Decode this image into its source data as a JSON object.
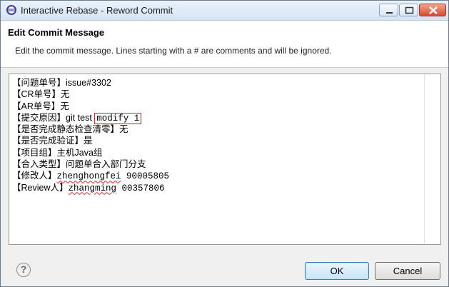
{
  "window": {
    "title": "Interactive Rebase - Reword Commit"
  },
  "header": {
    "title": "Edit Commit Message",
    "description": "Edit the commit message. Lines starting with a # are comments and will be ignored."
  },
  "editor": {
    "lines": [
      "【问题单号】issue#3302",
      "【CR单号】无",
      "【AR单号】无",
      "【提交原因】git test ",
      "modify 1",
      "【是否完成静态检查清零】无",
      "【是否完成验证】是",
      "【项目组】主机Java组",
      "【合入类型】问题单合入部门分支",
      "【修改人】",
      "zhenghongfei",
      " 90005805",
      "【Review人】",
      "zhangming",
      " 00357806"
    ]
  },
  "footer": {
    "help_glyph": "?",
    "ok_label": "OK",
    "cancel_label": "Cancel"
  }
}
